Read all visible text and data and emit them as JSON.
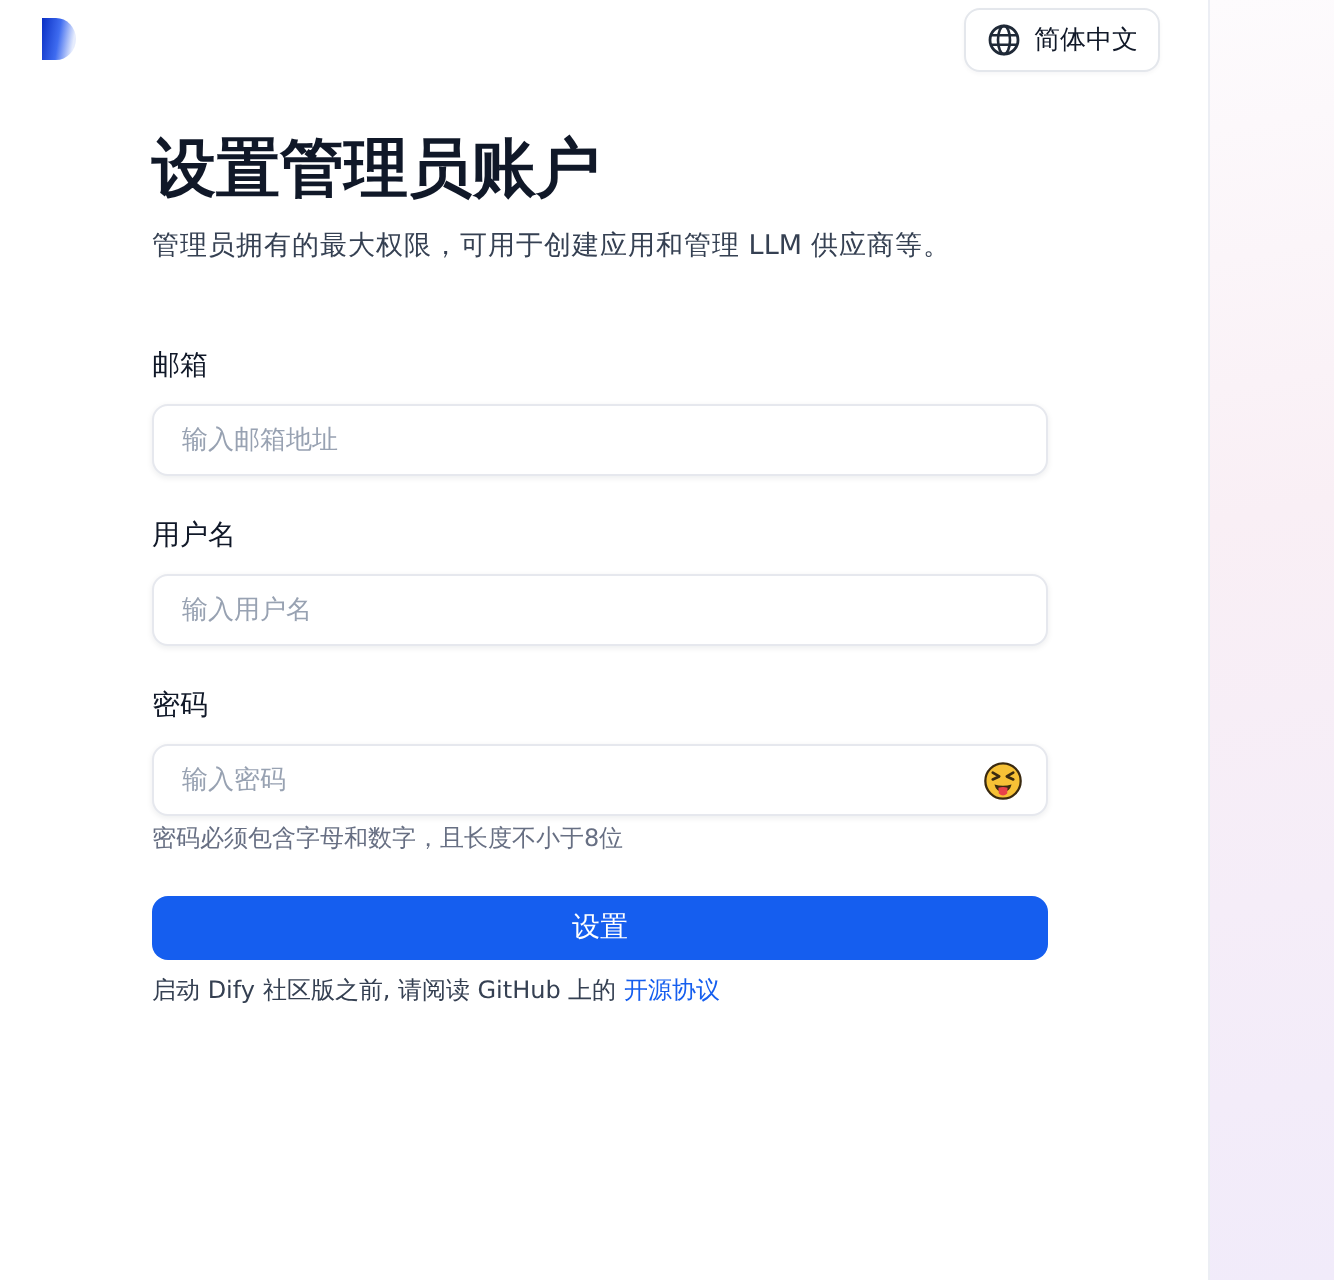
{
  "language_button": {
    "label": "简体中文"
  },
  "title": "设置管理员账户",
  "subtitle": "管理员拥有的最大权限，可用于创建应用和管理 LLM 供应商等。",
  "fields": [
    {
      "kind": "email",
      "label": "邮箱",
      "placeholder": "输入邮箱地址"
    },
    {
      "kind": "text",
      "label": "用户名",
      "placeholder": "输入用户名"
    },
    {
      "kind": "password",
      "label": "密码",
      "placeholder": "输入密码",
      "hint": "密码必须包含字母和数字，且长度不小于8位"
    }
  ],
  "submit_button": {
    "label": "设置"
  },
  "footer": {
    "text": "启动 Dify 社区版之前, 请阅读 GitHub 上的",
    "link": "开源协议"
  }
}
